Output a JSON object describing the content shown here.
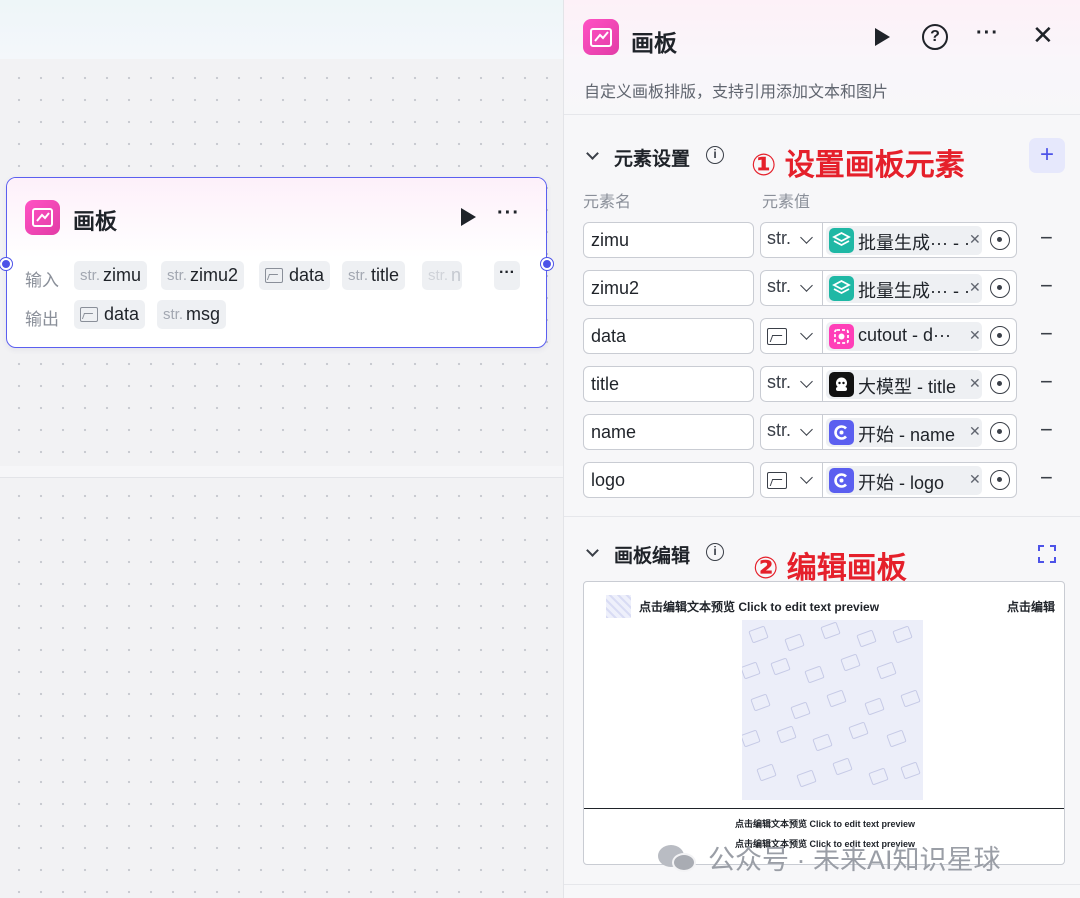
{
  "canvas": {
    "node": {
      "title": "画板",
      "input_label": "输入",
      "output_label": "输出",
      "inputs": [
        {
          "prefix": "str.",
          "name": "zimu"
        },
        {
          "prefix": "str.",
          "name": "zimu2"
        },
        {
          "prefix": "",
          "name": "data",
          "type": "image"
        },
        {
          "prefix": "str.",
          "name": "title"
        },
        {
          "prefix": "str.",
          "name": "n"
        }
      ],
      "more_label": "···",
      "outputs": [
        {
          "prefix": "",
          "name": "data",
          "type": "image"
        },
        {
          "prefix": "str.",
          "name": "msg"
        }
      ]
    }
  },
  "panel": {
    "title": "画板",
    "description": "自定义画板排版，支持引用添加文本和图片",
    "help_label": "?",
    "more_label": "···",
    "close_label": "✕",
    "elements_section": {
      "title": "元素设置",
      "annotation": "① 设置画板元素",
      "add_label": "+",
      "col_name": "元素名",
      "col_value": "元素值",
      "rows": [
        {
          "name": "zimu",
          "type": "str.",
          "ref_icon": "layers-icon",
          "ref_color": "#1fb8a5",
          "ref_text": "批量生成··· - ···"
        },
        {
          "name": "zimu2",
          "type": "str.",
          "ref_icon": "layers-icon",
          "ref_color": "#1fb8a5",
          "ref_text": "批量生成··· - ···"
        },
        {
          "name": "data",
          "type": "image",
          "ref_icon": "cutout-icon",
          "ref_color": "#ff3fb8",
          "ref_text": "cutout - d···"
        },
        {
          "name": "title",
          "type": "str.",
          "ref_icon": "llm-icon",
          "ref_color": "#111111",
          "ref_text": "大模型 - title"
        },
        {
          "name": "name",
          "type": "str.",
          "ref_icon": "start-icon",
          "ref_color": "#5b5ff0",
          "ref_text": "开始 - name"
        },
        {
          "name": "logo",
          "type": "image",
          "ref_icon": "start-icon",
          "ref_color": "#5b5ff0",
          "ref_text": "开始 - logo"
        }
      ]
    },
    "editor_section": {
      "title": "画板编辑",
      "annotation": "② 编辑画板",
      "preview": {
        "text1": "点击编辑文本预览 Click to edit text preview",
        "edit_label": "点击编辑",
        "text2": "点击编辑文本预览 Click to edit text preview",
        "text3": "点击编辑文本预览 Click to edit text preview"
      }
    }
  },
  "watermark": "公众号 · 未来AI知识星球",
  "colors": {
    "accent": "#4d53e8",
    "brand_pink": "#ff52c4",
    "annotation_red": "#e5202b"
  }
}
